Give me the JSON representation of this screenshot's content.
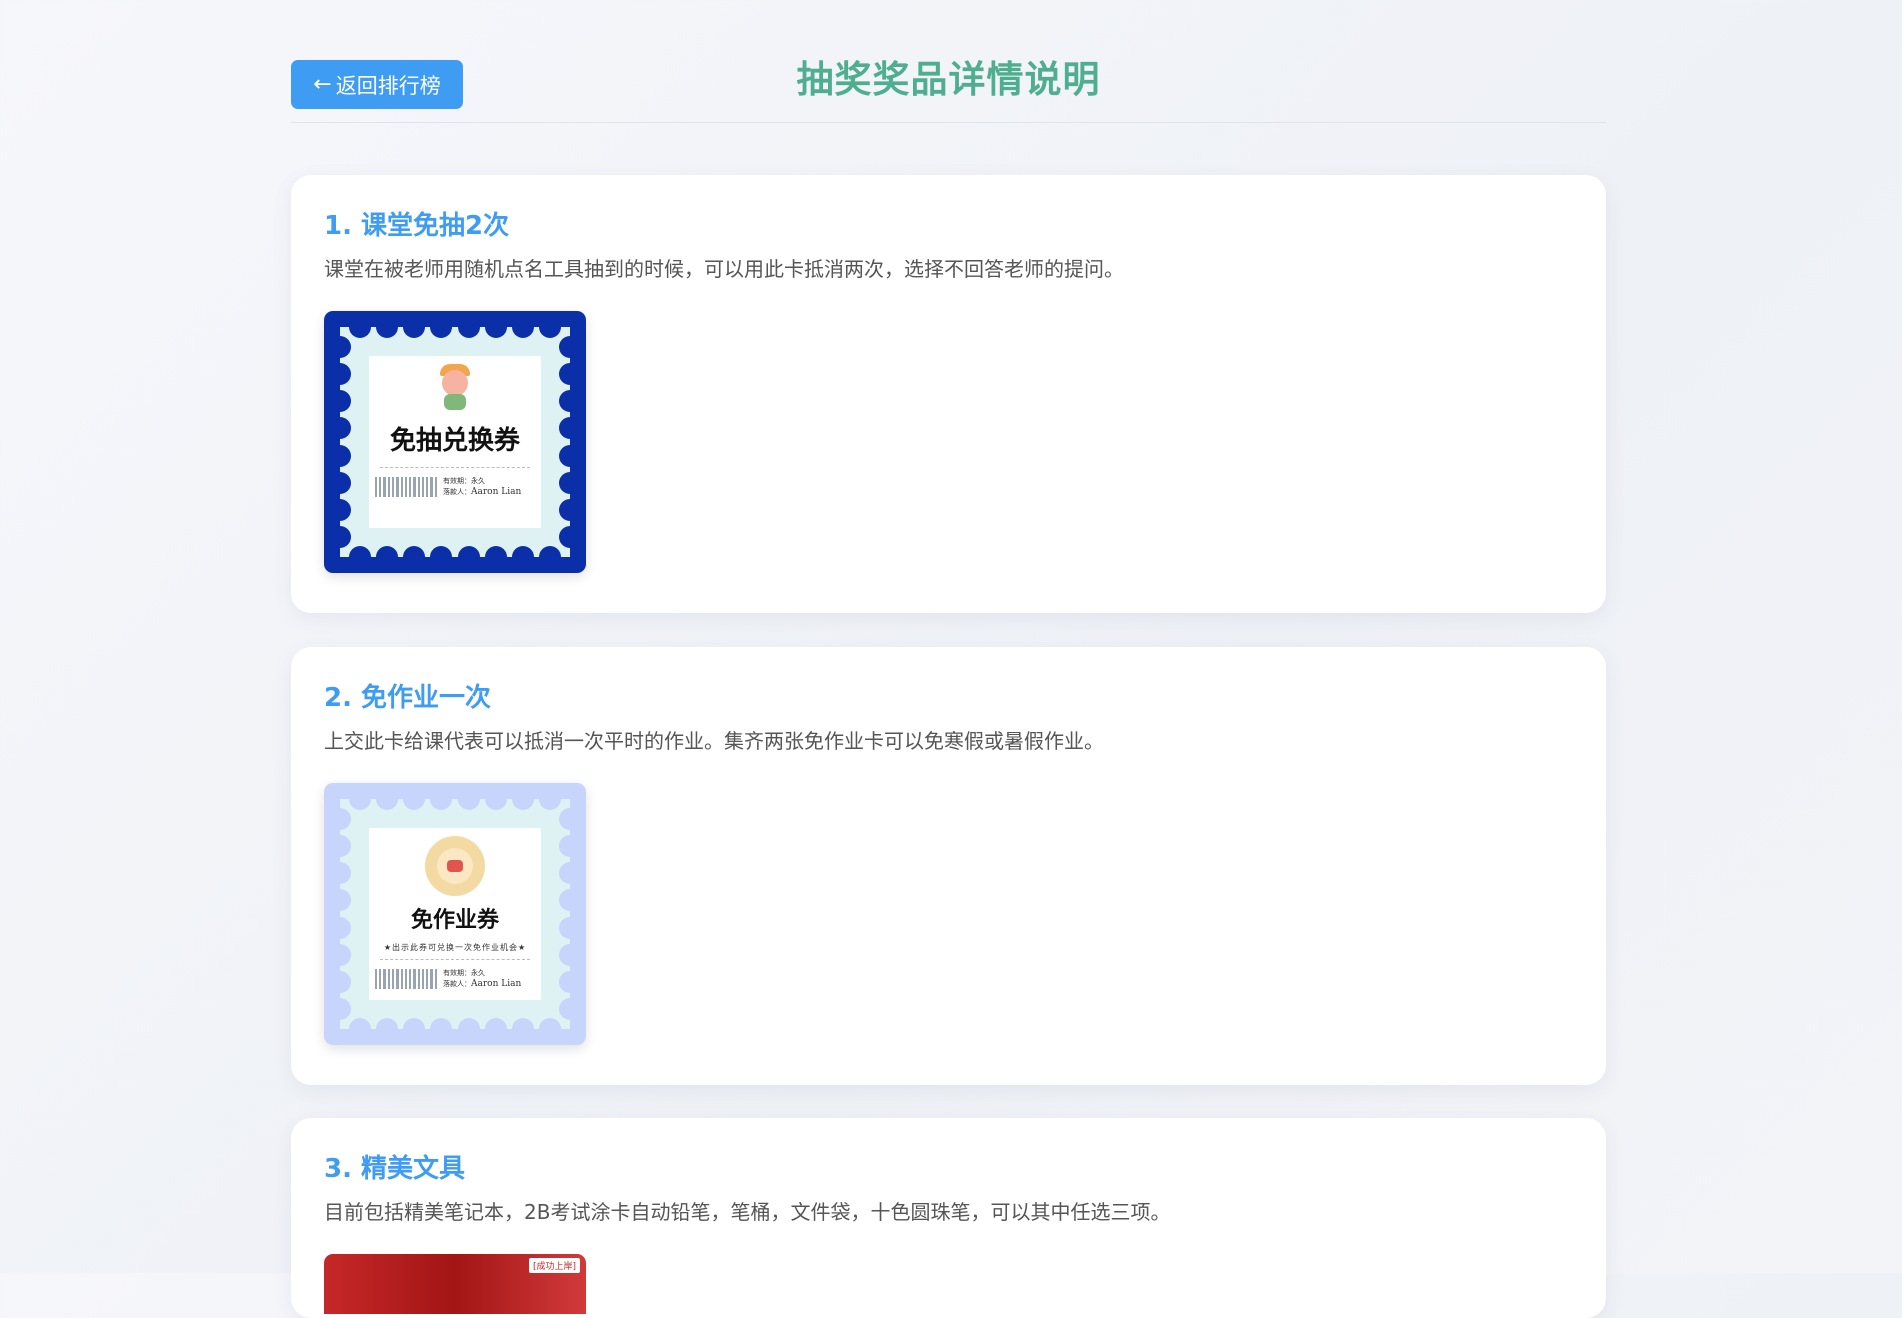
{
  "header": {
    "back_label": "返回排行榜",
    "back_arrow": "←",
    "title": "抽奖奖品详情说明"
  },
  "prizes": [
    {
      "title": "1. 课堂免抽2次",
      "description": "课堂在被老师用随机点名工具抽到的时候，可以用此卡抵消两次，选择不回答老师的提问。",
      "coupon": {
        "title": "免抽兑换券",
        "validity_label": "有效期：",
        "validity_value": "永久",
        "issuer_label": "落款人：",
        "issuer_value": "Aaron Lian",
        "frame_color": "#0a2fa8"
      }
    },
    {
      "title": "2. 免作业一次",
      "description": "上交此卡给课代表可以抵消一次平时的作业。集齐两张免作业卡可以免寒假或暑假作业。",
      "coupon": {
        "title": "免作业券",
        "subtitle": "★出示此券可兑换一次免作业机会★",
        "validity_label": "有效期：",
        "validity_value": "永久",
        "issuer_label": "落款人：",
        "issuer_value": "Aaron Lian",
        "frame_color": "#c7d4fb"
      }
    },
    {
      "title": "3. 精美文具",
      "description": "目前包括精美笔记本，2B考试涂卡自动铅笔，笔桶，文件袋，十色圆珠笔，可以其中任选三项。",
      "image_tag": "[成功上岸]"
    }
  ]
}
